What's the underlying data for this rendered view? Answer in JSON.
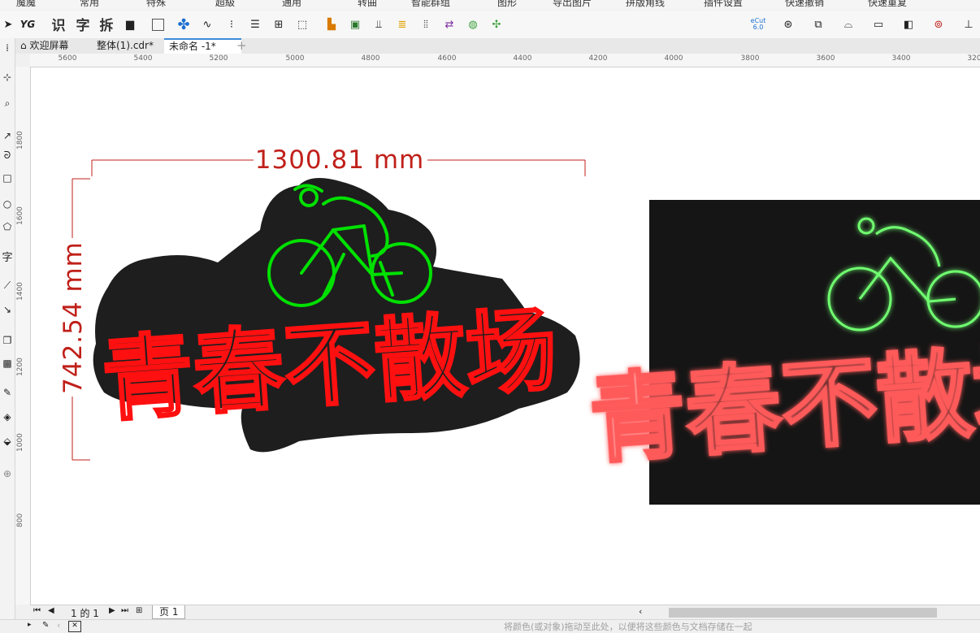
{
  "menubar": {
    "items": [
      "魔魔",
      "常用",
      "特殊",
      "超級",
      "通用",
      "转曲",
      "智能群组",
      "图形",
      "导出图片",
      "拼版角线",
      "插件设置",
      "快速撤销",
      "快速重复"
    ]
  },
  "toolbar": {
    "text_tools": [
      "识",
      "字",
      "拆"
    ],
    "logo": "YG",
    "ecut_label": "eCut 6.0"
  },
  "tabs": [
    {
      "label": "欢迎屏幕",
      "active": false
    },
    {
      "label": "整体(1).cdr*",
      "active": false
    },
    {
      "label": "未命名 -1*",
      "active": true
    }
  ],
  "new_tab_symbol": "+",
  "hruler": {
    "labels": [
      "5600",
      "5400",
      "5200",
      "5000",
      "4800",
      "4600",
      "4400",
      "4200",
      "4000",
      "3800",
      "3600",
      "3400",
      "320"
    ]
  },
  "vruler": {
    "labels": [
      "1800",
      "1600",
      "1400",
      "1200",
      "1000",
      "800"
    ]
  },
  "canvas": {
    "dimension_width": "1300.81 mm",
    "dimension_height": "742.54 mm",
    "artwork_text": "青春不散场"
  },
  "pagenav": {
    "page_info": "1 的 1",
    "page_tab": "页 1"
  },
  "status": {
    "hint": "将颜色(或对象)拖动至此处，以便将这些颜色与文档存储在一起"
  },
  "colors": {
    "neon_red": "#ff1010",
    "neon_green": "#00e000",
    "dimension_red": "#c0201a",
    "backing": "#1e1e1e"
  }
}
